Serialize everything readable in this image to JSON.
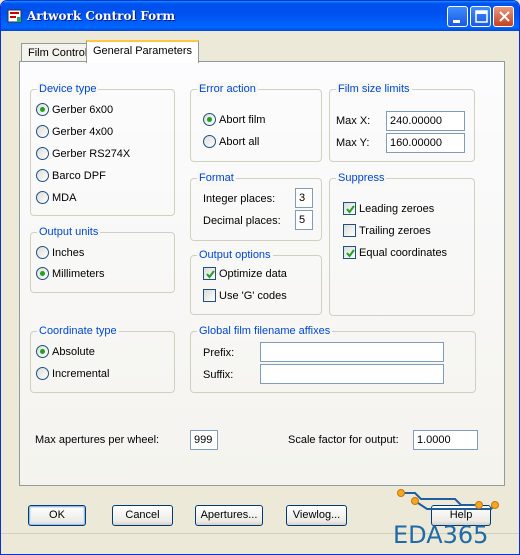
{
  "window": {
    "title": "Artwork Control Form"
  },
  "tabs": [
    "Film Control",
    "General Parameters"
  ],
  "device_type": {
    "label": "Device type",
    "options": [
      "Gerber 6x00",
      "Gerber 4x00",
      "Gerber RS274X",
      "Barco DPF",
      "MDA"
    ],
    "selected": "Gerber 6x00"
  },
  "output_units": {
    "label": "Output units",
    "options": [
      "Inches",
      "Millimeters"
    ],
    "selected": "Millimeters"
  },
  "coordinate_type": {
    "label": "Coordinate type",
    "options": [
      "Absolute",
      "Incremental"
    ],
    "selected": "Absolute"
  },
  "error_action": {
    "label": "Error action",
    "options": [
      "Abort film",
      "Abort all"
    ],
    "selected": "Abort film"
  },
  "format": {
    "label": "Format",
    "integer_label": "Integer places:",
    "integer_value": "3",
    "decimal_label": "Decimal places:",
    "decimal_value": "5"
  },
  "output_options": {
    "label": "Output options",
    "items": [
      {
        "label": "Optimize data",
        "checked": true
      },
      {
        "label": "Use 'G' codes",
        "checked": false
      }
    ]
  },
  "film_size": {
    "label": "Film size limits",
    "maxx_label": "Max X:",
    "maxx_value": "240.00000",
    "maxy_label": "Max Y:",
    "maxy_value": "160.00000"
  },
  "suppress": {
    "label": "Suppress",
    "items": [
      {
        "label": "Leading zeroes",
        "checked": true
      },
      {
        "label": "Trailing zeroes",
        "checked": false
      },
      {
        "label": "Equal coordinates",
        "checked": true
      }
    ]
  },
  "affixes": {
    "label": "Global film filename affixes",
    "prefix_label": "Prefix:",
    "prefix_value": "",
    "suffix_label": "Suffix:",
    "suffix_value": ""
  },
  "max_apertures": {
    "label": "Max apertures per wheel:",
    "value": "999"
  },
  "scale_factor": {
    "label": "Scale factor for output:",
    "value": "1.0000"
  },
  "buttons": {
    "ok": "OK",
    "cancel": "Cancel",
    "apertures": "Apertures...",
    "viewlog": "Viewlog...",
    "help": "Help"
  },
  "watermark": "EDA365",
  "colors": {
    "group_label": "#0046D5",
    "titlebar": "#0055EA",
    "radio_on": "#21A121",
    "check_mark": "#21A121"
  }
}
